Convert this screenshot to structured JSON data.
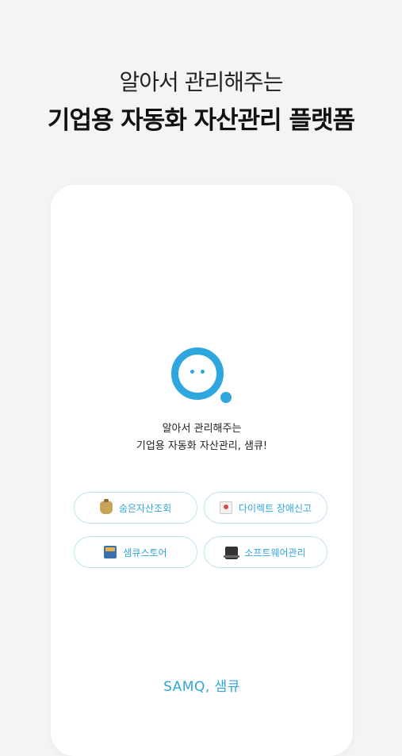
{
  "headline": {
    "sub": "알아서 관리해주는",
    "main": "기업용 자동화 자산관리 플랫폼"
  },
  "card": {
    "tagline_line1": "알아서 관리해주는",
    "tagline_line2": "기업용 자동화 자산관리, 샘큐!",
    "buttons": [
      {
        "label": "숨은자산조회",
        "icon": "money-bag-icon"
      },
      {
        "label": "다이렉트 장애신고",
        "icon": "mailbox-icon"
      },
      {
        "label": "샘큐스토어",
        "icon": "store-icon"
      },
      {
        "label": "소프트웨어관리",
        "icon": "laptop-icon"
      }
    ],
    "footer": "SAMQ, 샘큐"
  },
  "colors": {
    "accent": "#2ea6de",
    "background": "#f4f4f4",
    "card": "#ffffff"
  }
}
